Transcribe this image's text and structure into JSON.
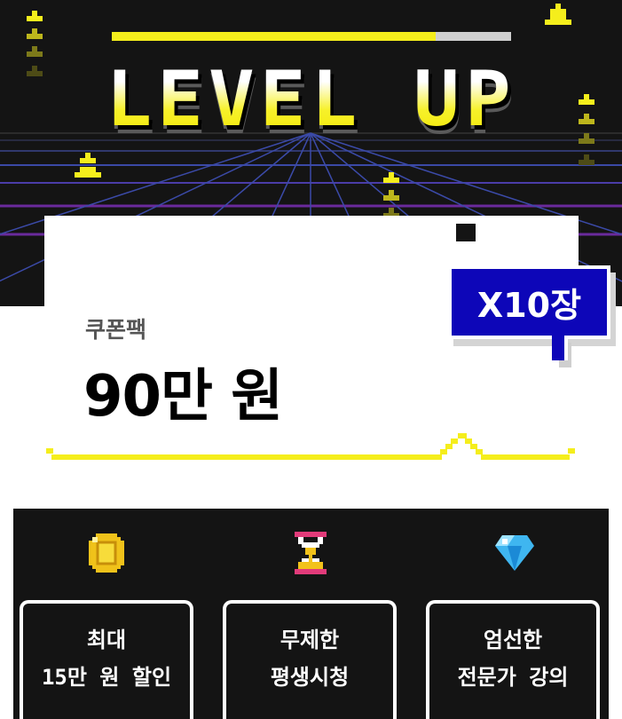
{
  "hero": {
    "title": "LEVEL UP",
    "progress": 0.81,
    "colors": {
      "background": "#141414",
      "accent_yellow": "#f5ee1c",
      "grid_purple": "#6a2a9c"
    }
  },
  "offer": {
    "label": "쿠폰팩",
    "price": "90만 원",
    "badge": "X10장",
    "colors": {
      "badge_bg": "#0d06b8"
    }
  },
  "features": [
    {
      "icon": "coin-icon",
      "line1": "최대",
      "line2": "15만 원 할인"
    },
    {
      "icon": "hourglass-icon",
      "line1": "무제한",
      "line2": "평생시청"
    },
    {
      "icon": "diamond-icon",
      "line1": "엄선한",
      "line2": "전문가 강의"
    }
  ]
}
